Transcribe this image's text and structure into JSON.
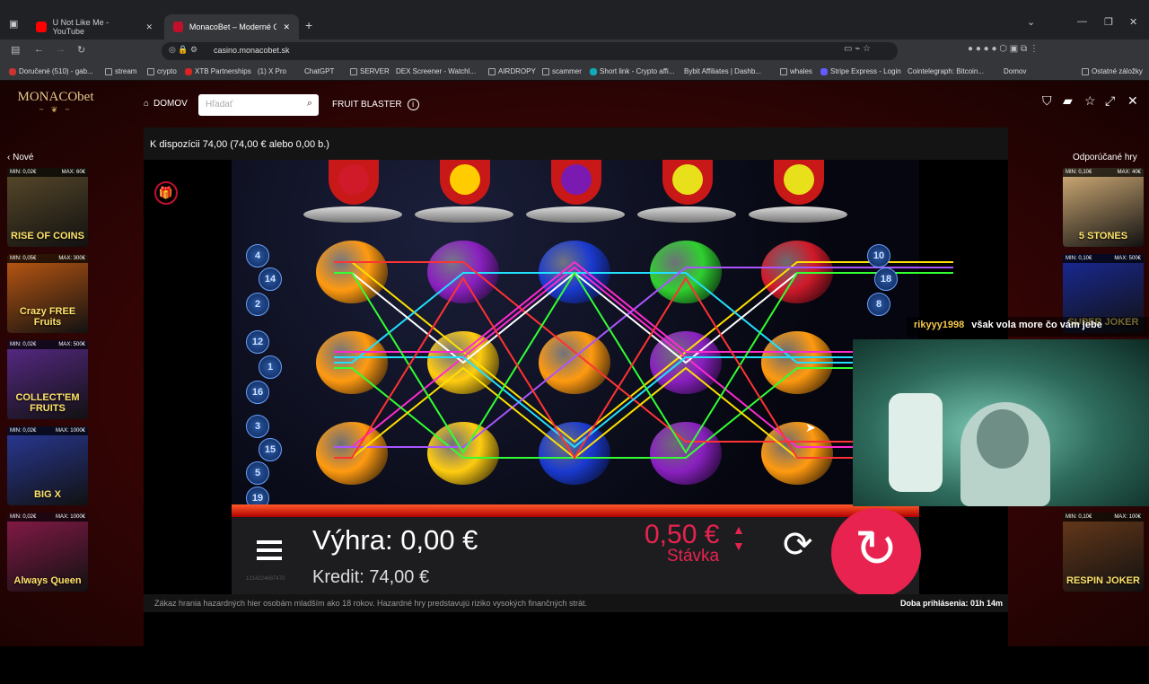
{
  "browser": {
    "tabs": [
      {
        "title": "U Not Like Me - YouTube",
        "active": false
      },
      {
        "title": "MonacoBet – Moderné Online K",
        "active": true
      }
    ],
    "new_tab": "+",
    "url": "casino.monacobet.sk",
    "bookmarks": [
      "Doručené (510) - gab...",
      "stream",
      "crypto",
      "XTB Partnerships",
      "(1) X Pro",
      "ChatGPT",
      "SERVER",
      "DEX Screener - Watchl...",
      "AIRDROPY",
      "scammer",
      "Short link - Crypto affi...",
      "Bybit Affiliates | Dashb...",
      "whales",
      "Stripe Express - Login",
      "Cointelegraph: Bitcoin...",
      "Domov",
      "Ostatné záložky"
    ]
  },
  "site": {
    "logo": "MONACObet",
    "nav_home": "DOMOV",
    "search_placeholder": "Hľadať",
    "game_name": "FRUIT BLASTER",
    "left_title": "Nové",
    "right_title": "Odporúčané hry",
    "left_cards": [
      {
        "min": "MIN: 0,02€",
        "max": "MAX: 60€",
        "name": "RISE OF COINS",
        "color": "#5a4a2a"
      },
      {
        "min": "MIN: 0,05€",
        "max": "MAX: 300€",
        "name": "Crazy FREE Fruits",
        "color": "#c25a12"
      },
      {
        "min": "MIN: 0,02€",
        "max": "MAX: 500€",
        "name": "COLLECT'EM FRUITS",
        "color": "#5a2a8a"
      },
      {
        "min": "MIN: 0,02€",
        "max": "MAX: 1000€",
        "name": "BIG X",
        "color": "#2a3a9a"
      },
      {
        "min": "MIN: 0,02€",
        "max": "MAX: 1000€",
        "name": "Always Queen",
        "color": "#8a1a4a"
      }
    ],
    "right_cards": [
      {
        "min": "MIN: 0,10€",
        "max": "MAX: 40€",
        "name": "5 STONES",
        "color": "#d8b27a"
      },
      {
        "min": "MIN: 0,10€",
        "max": "MAX: 500€",
        "name": "SUPER JOKER",
        "color": "#1a2a9a"
      },
      {
        "min": "MIN: 0,10€",
        "max": "MAX: 100€",
        "name": "RESPIN JOKER",
        "color": "#6a3a1a"
      }
    ],
    "available": "K dispozícii 74,00 (74,00 € alebo 0,00 b.)",
    "disclaimer": "Zákaz hrania hazardných hier osobám mladším ako 18 rokov. Hazardné hry predstavujú riziko vysokých finančných strát.",
    "session": "Doba prihlásenia: 01h 14m"
  },
  "game": {
    "ufo_symbols": [
      {
        "name": "cherry",
        "color": "#d01a2a"
      },
      {
        "name": "star",
        "color": "#ffcc00"
      },
      {
        "name": "plum",
        "color": "#7a1ab0"
      },
      {
        "name": "lemon",
        "color": "#e8e01a"
      },
      {
        "name": "lemon",
        "color": "#e8e01a"
      }
    ],
    "reels": [
      [
        "#ff9a10",
        "#ff9a10",
        "#ff9a10"
      ],
      [
        "#8a20c0",
        "#ffcc10",
        "#ffcc10"
      ],
      [
        "#1a3ad0",
        "#ff9a10",
        "#1a3ad0"
      ],
      [
        "#30d030",
        "#8a20c0",
        "#8a20c0"
      ],
      [
        "#d01a2a",
        "#ff9a10",
        "#ff9a10"
      ]
    ],
    "lines_left": [
      "4",
      "14",
      "2",
      "12",
      "1",
      "16",
      "3",
      "15",
      "5",
      "19"
    ],
    "lines_right": [
      "10",
      "18",
      "8"
    ],
    "win_label": "Výhra:",
    "win_value": "0,00 €",
    "credit_label": "Kredit:",
    "credit_value": "74,00 €",
    "bet_value": "0,50 €",
    "bet_label": "Stávka",
    "round_id": "1214224687470"
  },
  "stream": {
    "chat_user": "rikyyy1998",
    "chat_message": "však vola more čo vám jebe"
  }
}
